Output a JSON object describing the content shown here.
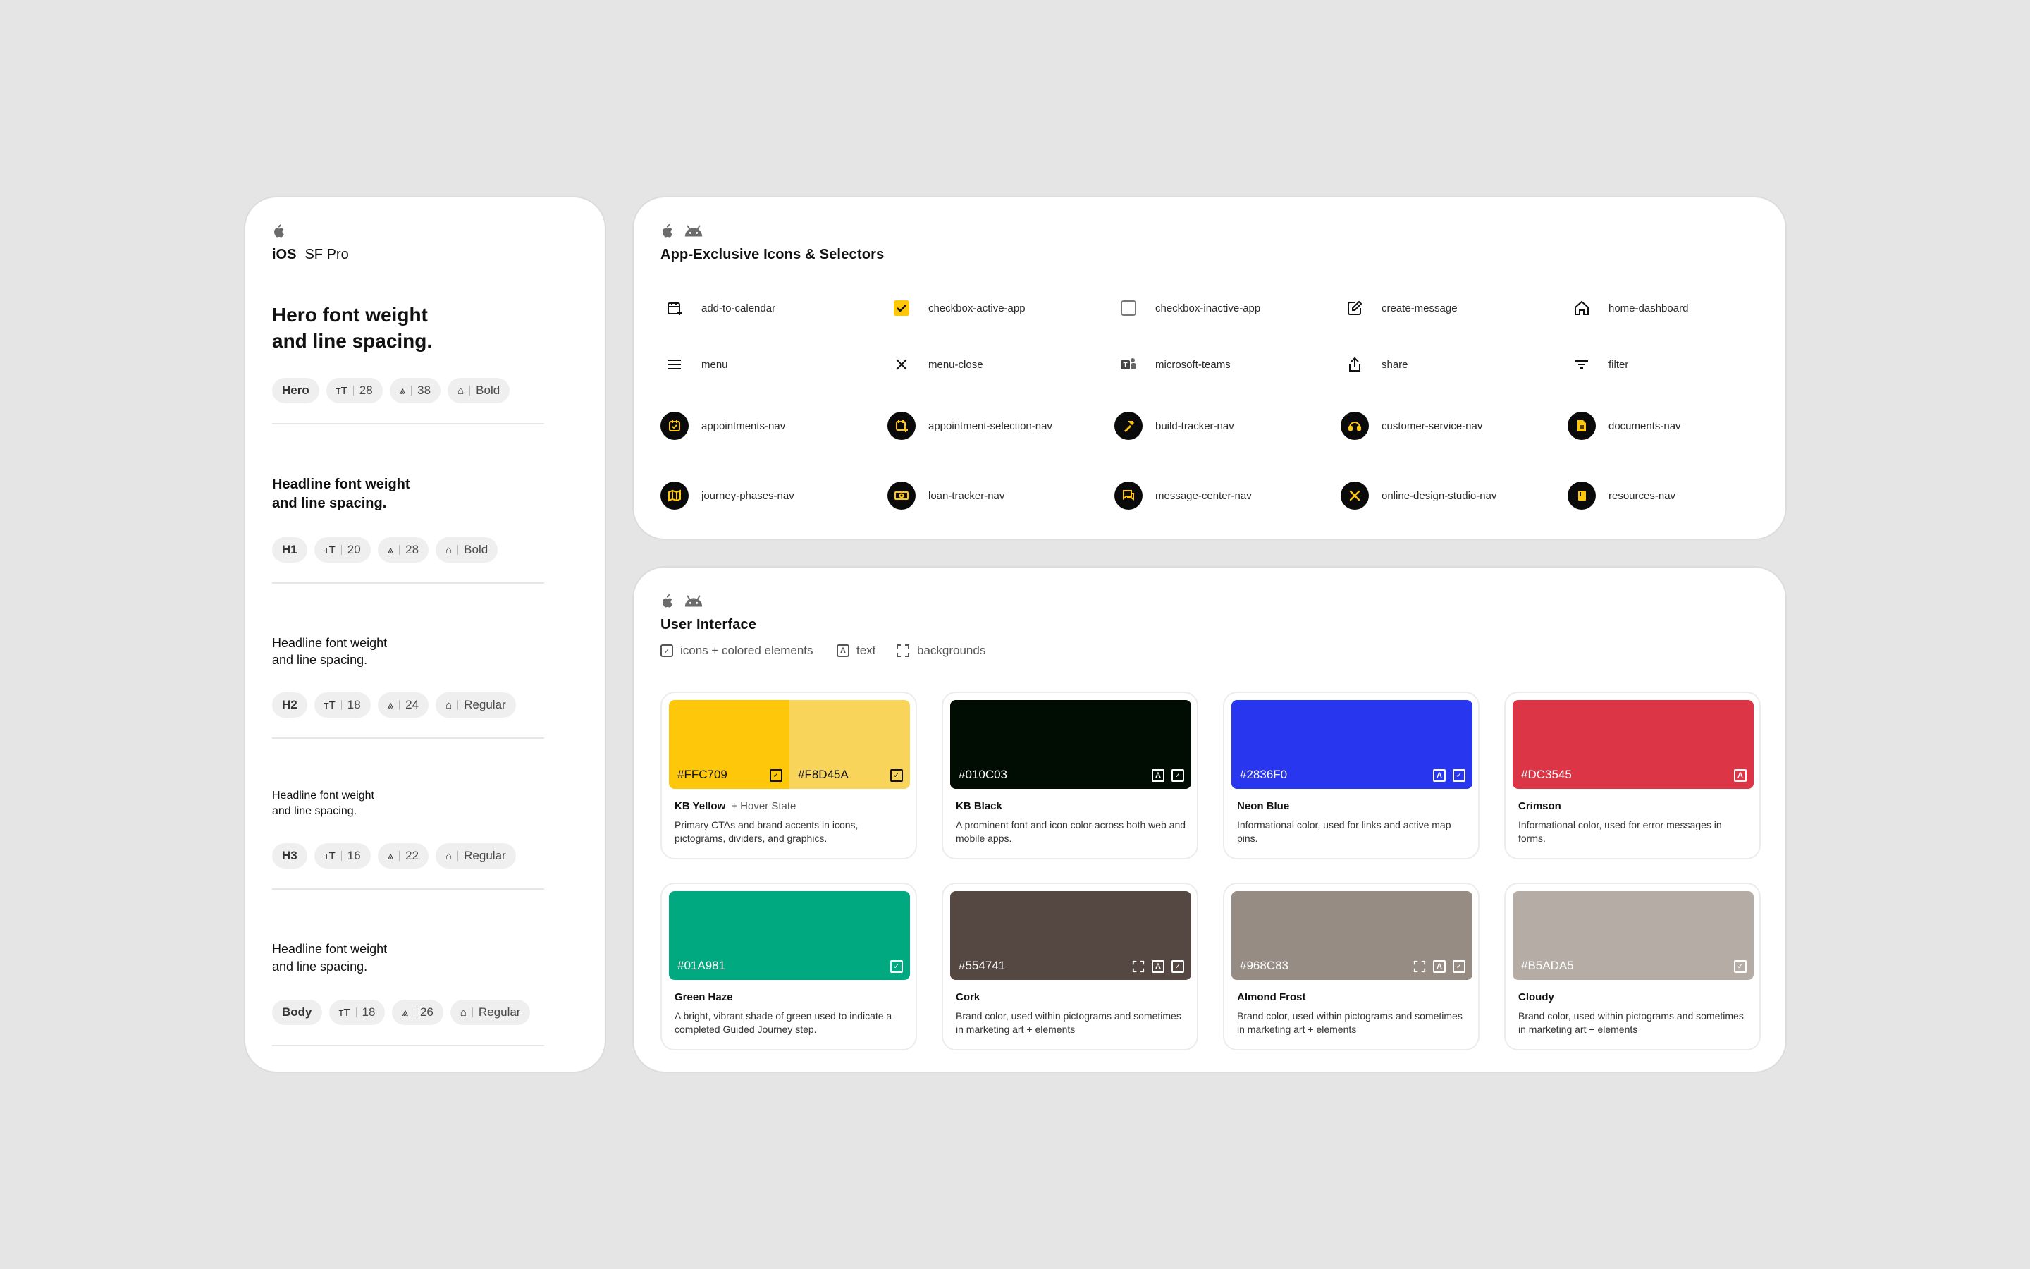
{
  "typography": {
    "platform": "iOS",
    "font_family_label": "SF Pro",
    "styles": [
      {
        "sample_line1": "Hero font weight",
        "sample_line2": "and line spacing.",
        "tag": "Hero",
        "size": "28",
        "line_height": "38",
        "weight": "Bold"
      },
      {
        "sample_line1": "Headline font weight",
        "sample_line2": "and line spacing.",
        "tag": "H1",
        "size": "20",
        "line_height": "28",
        "weight": "Bold"
      },
      {
        "sample_line1": "Headline font weight",
        "sample_line2": "and line spacing.",
        "tag": "H2",
        "size": "18",
        "line_height": "24",
        "weight": "Regular"
      },
      {
        "sample_line1": "Headline font weight",
        "sample_line2": "and line spacing.",
        "tag": "H3",
        "size": "16",
        "line_height": "22",
        "weight": "Regular"
      },
      {
        "sample_line1": "Headline font weight",
        "sample_line2": "and line spacing.",
        "tag": "Body",
        "size": "18",
        "line_height": "26",
        "weight": "Regular"
      }
    ]
  },
  "icons_section": {
    "title": "App-Exclusive Icons & Selectors",
    "items": [
      {
        "label": "add-to-calendar",
        "icon": "calendar-add-icon"
      },
      {
        "label": "checkbox-active-app",
        "icon": "checkbox-checked-icon"
      },
      {
        "label": "checkbox-inactive-app",
        "icon": "checkbox-empty-icon"
      },
      {
        "label": "create-message",
        "icon": "compose-icon"
      },
      {
        "label": "home-dashboard",
        "icon": "home-icon"
      },
      {
        "label": "menu",
        "icon": "hamburger-icon"
      },
      {
        "label": "menu-close",
        "icon": "close-icon"
      },
      {
        "label": "microsoft-teams",
        "icon": "teams-icon"
      },
      {
        "label": "share",
        "icon": "share-icon"
      },
      {
        "label": "filter",
        "icon": "filter-icon"
      },
      {
        "label": "appointments-nav",
        "icon": "appointments-nav-icon"
      },
      {
        "label": "appointment-selection-nav",
        "icon": "appointment-selection-nav-icon"
      },
      {
        "label": "build-tracker-nav",
        "icon": "hammer-nav-icon"
      },
      {
        "label": "customer-service-nav",
        "icon": "headset-nav-icon"
      },
      {
        "label": "documents-nav",
        "icon": "document-nav-icon"
      },
      {
        "label": "journey-phases-nav",
        "icon": "map-nav-icon"
      },
      {
        "label": "loan-tracker-nav",
        "icon": "money-nav-icon"
      },
      {
        "label": "message-center-nav",
        "icon": "chat-nav-icon"
      },
      {
        "label": "online-design-studio-nav",
        "icon": "tools-nav-icon"
      },
      {
        "label": "resources-nav",
        "icon": "book-nav-icon"
      }
    ]
  },
  "ui_section": {
    "title": "User Interface",
    "legend": {
      "icons": "icons + colored elements",
      "text": "text",
      "backgrounds": "backgrounds"
    },
    "colors": [
      {
        "hex": "#FFC709",
        "hex2": "#F8D45A",
        "name": "KB Yellow",
        "sub": "+ Hover State",
        "desc": "Primary CTAs and brand accents in icons, pictograms, dividers, and graphics."
      },
      {
        "hex": "#010C03",
        "name": "KB Black",
        "desc": "A prominent font and icon color across both web and mobile apps."
      },
      {
        "hex": "#2836F0",
        "name": "Neon Blue",
        "desc": "Informational color, used for links and active map pins."
      },
      {
        "hex": "#DC3545",
        "name": "Crimson",
        "desc": "Informational color, used for error messages in forms."
      },
      {
        "hex": "#01A981",
        "name": "Green Haze",
        "desc": "A bright, vibrant shade of green used to indicate a completed Guided Journey step."
      },
      {
        "hex": "#554741",
        "name": "Cork",
        "desc": "Brand color, used within pictograms and sometimes in marketing art + elements"
      },
      {
        "hex": "#968C83",
        "name": "Almond Frost",
        "desc": "Brand color, used within pictograms and sometimes in marketing art + elements"
      },
      {
        "hex": "#B5ADA5",
        "name": "Cloudy",
        "desc": "Brand color, used within pictograms and sometimes in marketing art + elements"
      }
    ]
  }
}
